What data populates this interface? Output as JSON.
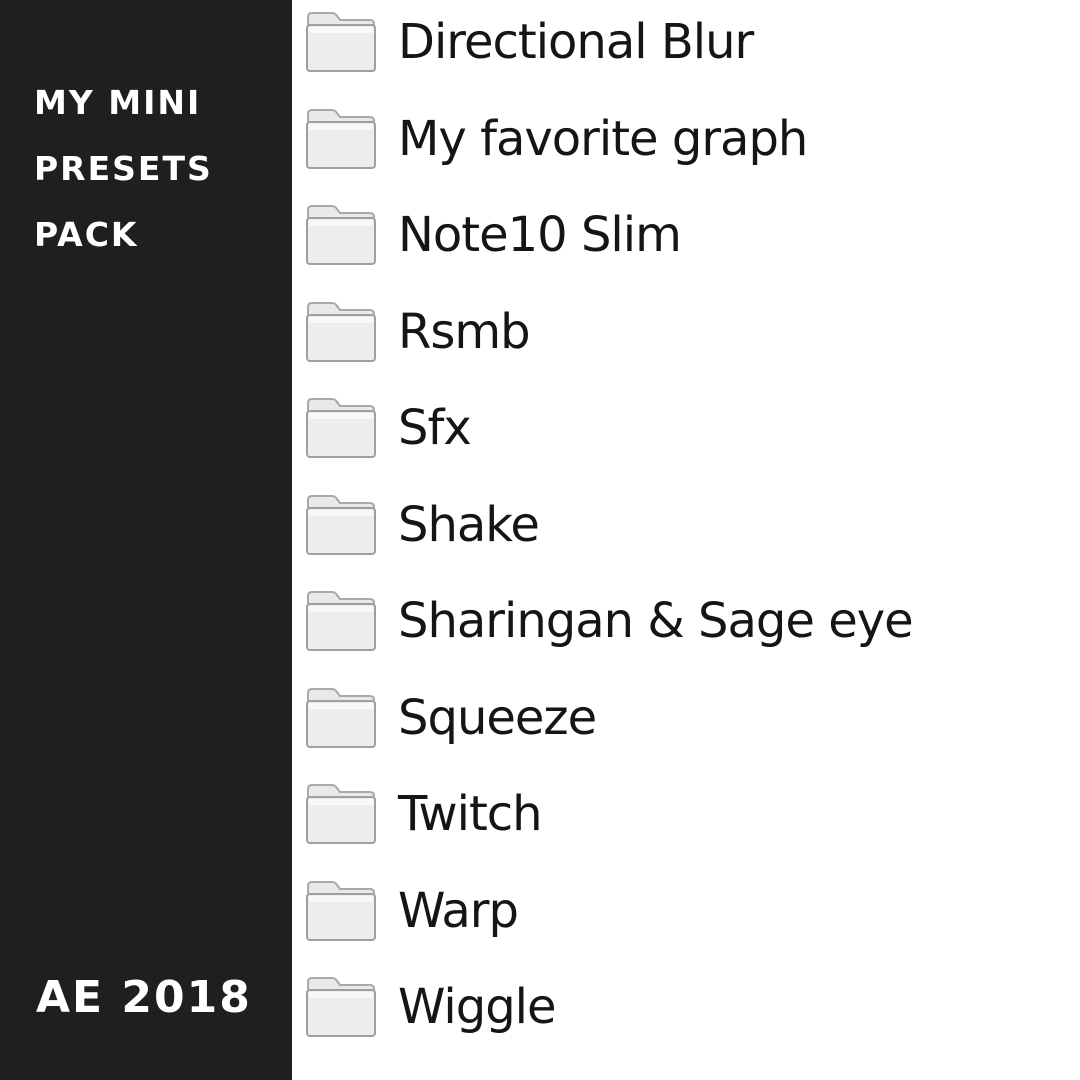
{
  "sidebar": {
    "title_lines": [
      "MY MINI",
      "PRESETS",
      "PACK"
    ],
    "version": "AE 2018",
    "background": "#1f1f1f",
    "text_color": "#ffffff"
  },
  "folders": {
    "icon": "folder-icon",
    "items": [
      {
        "label": "Directional Blur"
      },
      {
        "label": "My favorite graph"
      },
      {
        "label": "Note10 Slim"
      },
      {
        "label": "Rsmb"
      },
      {
        "label": "Sfx"
      },
      {
        "label": "Shake"
      },
      {
        "label": "Sharingan & Sage eye"
      },
      {
        "label": "Squeeze"
      },
      {
        "label": "Twitch"
      },
      {
        "label": "Warp"
      },
      {
        "label": "Wiggle"
      }
    ]
  }
}
